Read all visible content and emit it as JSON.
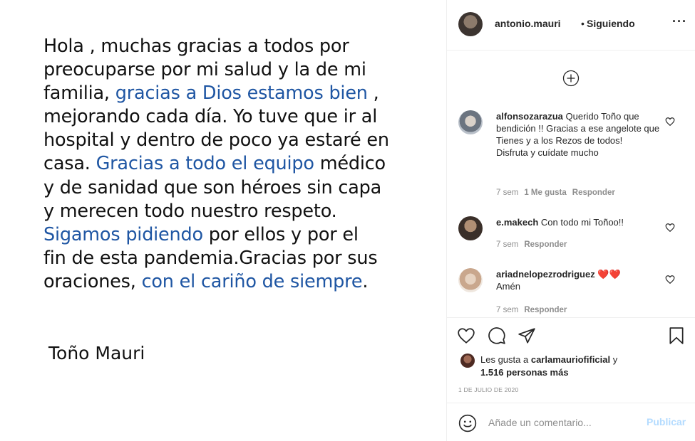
{
  "post": {
    "lines": [
      [
        {
          "t": "Hola , muchas gracias a todos por",
          "hl": false
        }
      ],
      [
        {
          "t": "preocuparse por mi salud y la de mi",
          "hl": false
        }
      ],
      [
        {
          "t": "familia, ",
          "hl": false
        },
        {
          "t": "gracias a Dios estamos bien",
          "hl": true
        },
        {
          "t": " ,",
          "hl": false
        }
      ],
      [
        {
          "t": "mejorando cada día. Yo tuve que ir al",
          "hl": false
        }
      ],
      [
        {
          "t": "hospital y dentro de poco ya estaré en",
          "hl": false
        }
      ],
      [
        {
          "t": "casa. ",
          "hl": false
        },
        {
          "t": "Gracias a todo el equipo",
          "hl": true
        },
        {
          "t": " médico",
          "hl": false
        }
      ],
      [
        {
          "t": "y de sanidad que son héroes sin capa",
          "hl": false
        }
      ],
      [
        {
          "t": "y merecen todo nuestro respeto.",
          "hl": false
        }
      ],
      [
        {
          "t": "Sigamos pidiendo",
          "hl": true
        },
        {
          "t": " por ellos  y por el",
          "hl": false
        }
      ],
      [
        {
          "t": "fin de esta pandemia.Gracias por sus",
          "hl": false
        }
      ],
      [
        {
          "t": "oraciones, ",
          "hl": false
        },
        {
          "t": "con el cariño de siempre",
          "hl": true
        },
        {
          "t": ".",
          "hl": false
        }
      ]
    ],
    "signature": "Toño Mauri",
    "highlight_color": "#1f56a3"
  },
  "header": {
    "username": "antonio.mauri",
    "separator": "•",
    "follow_status": "Siguiendo",
    "more_icon": "more-options-icon",
    "more_label": "···"
  },
  "comments": [
    {
      "user": "alfonsozarazua",
      "text": "Querido Toño que bendición !! Gracias a ese angelote que Tienes y a los Rezos de todos!",
      "text2": "Disfruta y cuídate mucho",
      "time": "7 sem",
      "likes": "1 Me gusta",
      "reply": "Responder"
    },
    {
      "user": "e.makech",
      "text": "Con todo mi Toñoo!!",
      "time": "7 sem",
      "reply": "Responder"
    },
    {
      "user": "ariadnelopezrodriguez",
      "hearts": "❤️❤️",
      "text": "Amén",
      "time": "7 sem",
      "reply": "Responder"
    }
  ],
  "actions": {
    "like_icon": "heart-icon",
    "comment_icon": "comment-icon",
    "share_icon": "share-icon",
    "save_icon": "bookmark-icon"
  },
  "likes": {
    "prefix": "Les gusta a",
    "user": "carlamauriofificial",
    "connector": "y",
    "others": "1.516 personas más"
  },
  "date": "1 DE JULIO DE 2020",
  "comment_box": {
    "placeholder": "Añade un comentario...",
    "publish_label": "Publicar"
  },
  "colors": {
    "text": "#262626",
    "muted": "#8e8e8e",
    "publish_disabled": "#b3dbff",
    "heart_red": "#ed4956"
  }
}
